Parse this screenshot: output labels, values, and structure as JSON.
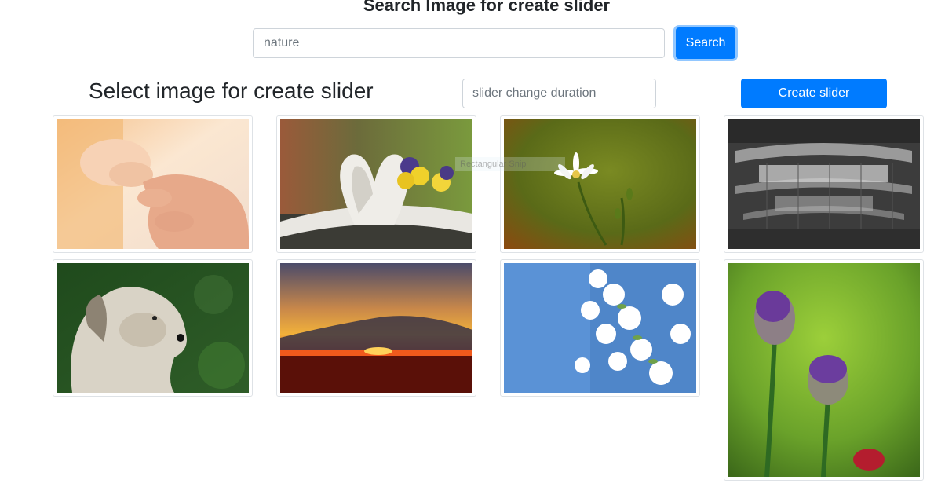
{
  "header": {
    "title": "Search Image for create slider"
  },
  "search": {
    "value": "nature",
    "button_label": "Search"
  },
  "slider": {
    "heading": "Select image for create slider",
    "duration_placeholder": "slider change duration",
    "create_label": "Create slider"
  },
  "images": [
    {
      "name": "image-hands"
    },
    {
      "name": "image-book-heart"
    },
    {
      "name": "image-daisy"
    },
    {
      "name": "image-abandoned-hall"
    },
    {
      "name": "image-dog"
    },
    {
      "name": "image-sunset"
    },
    {
      "name": "image-blossom"
    },
    {
      "name": "image-allium"
    }
  ],
  "overlay": {
    "label": "Rectangular Snip"
  },
  "colors": {
    "primary": "#007bff",
    "border": "#ced4da"
  }
}
